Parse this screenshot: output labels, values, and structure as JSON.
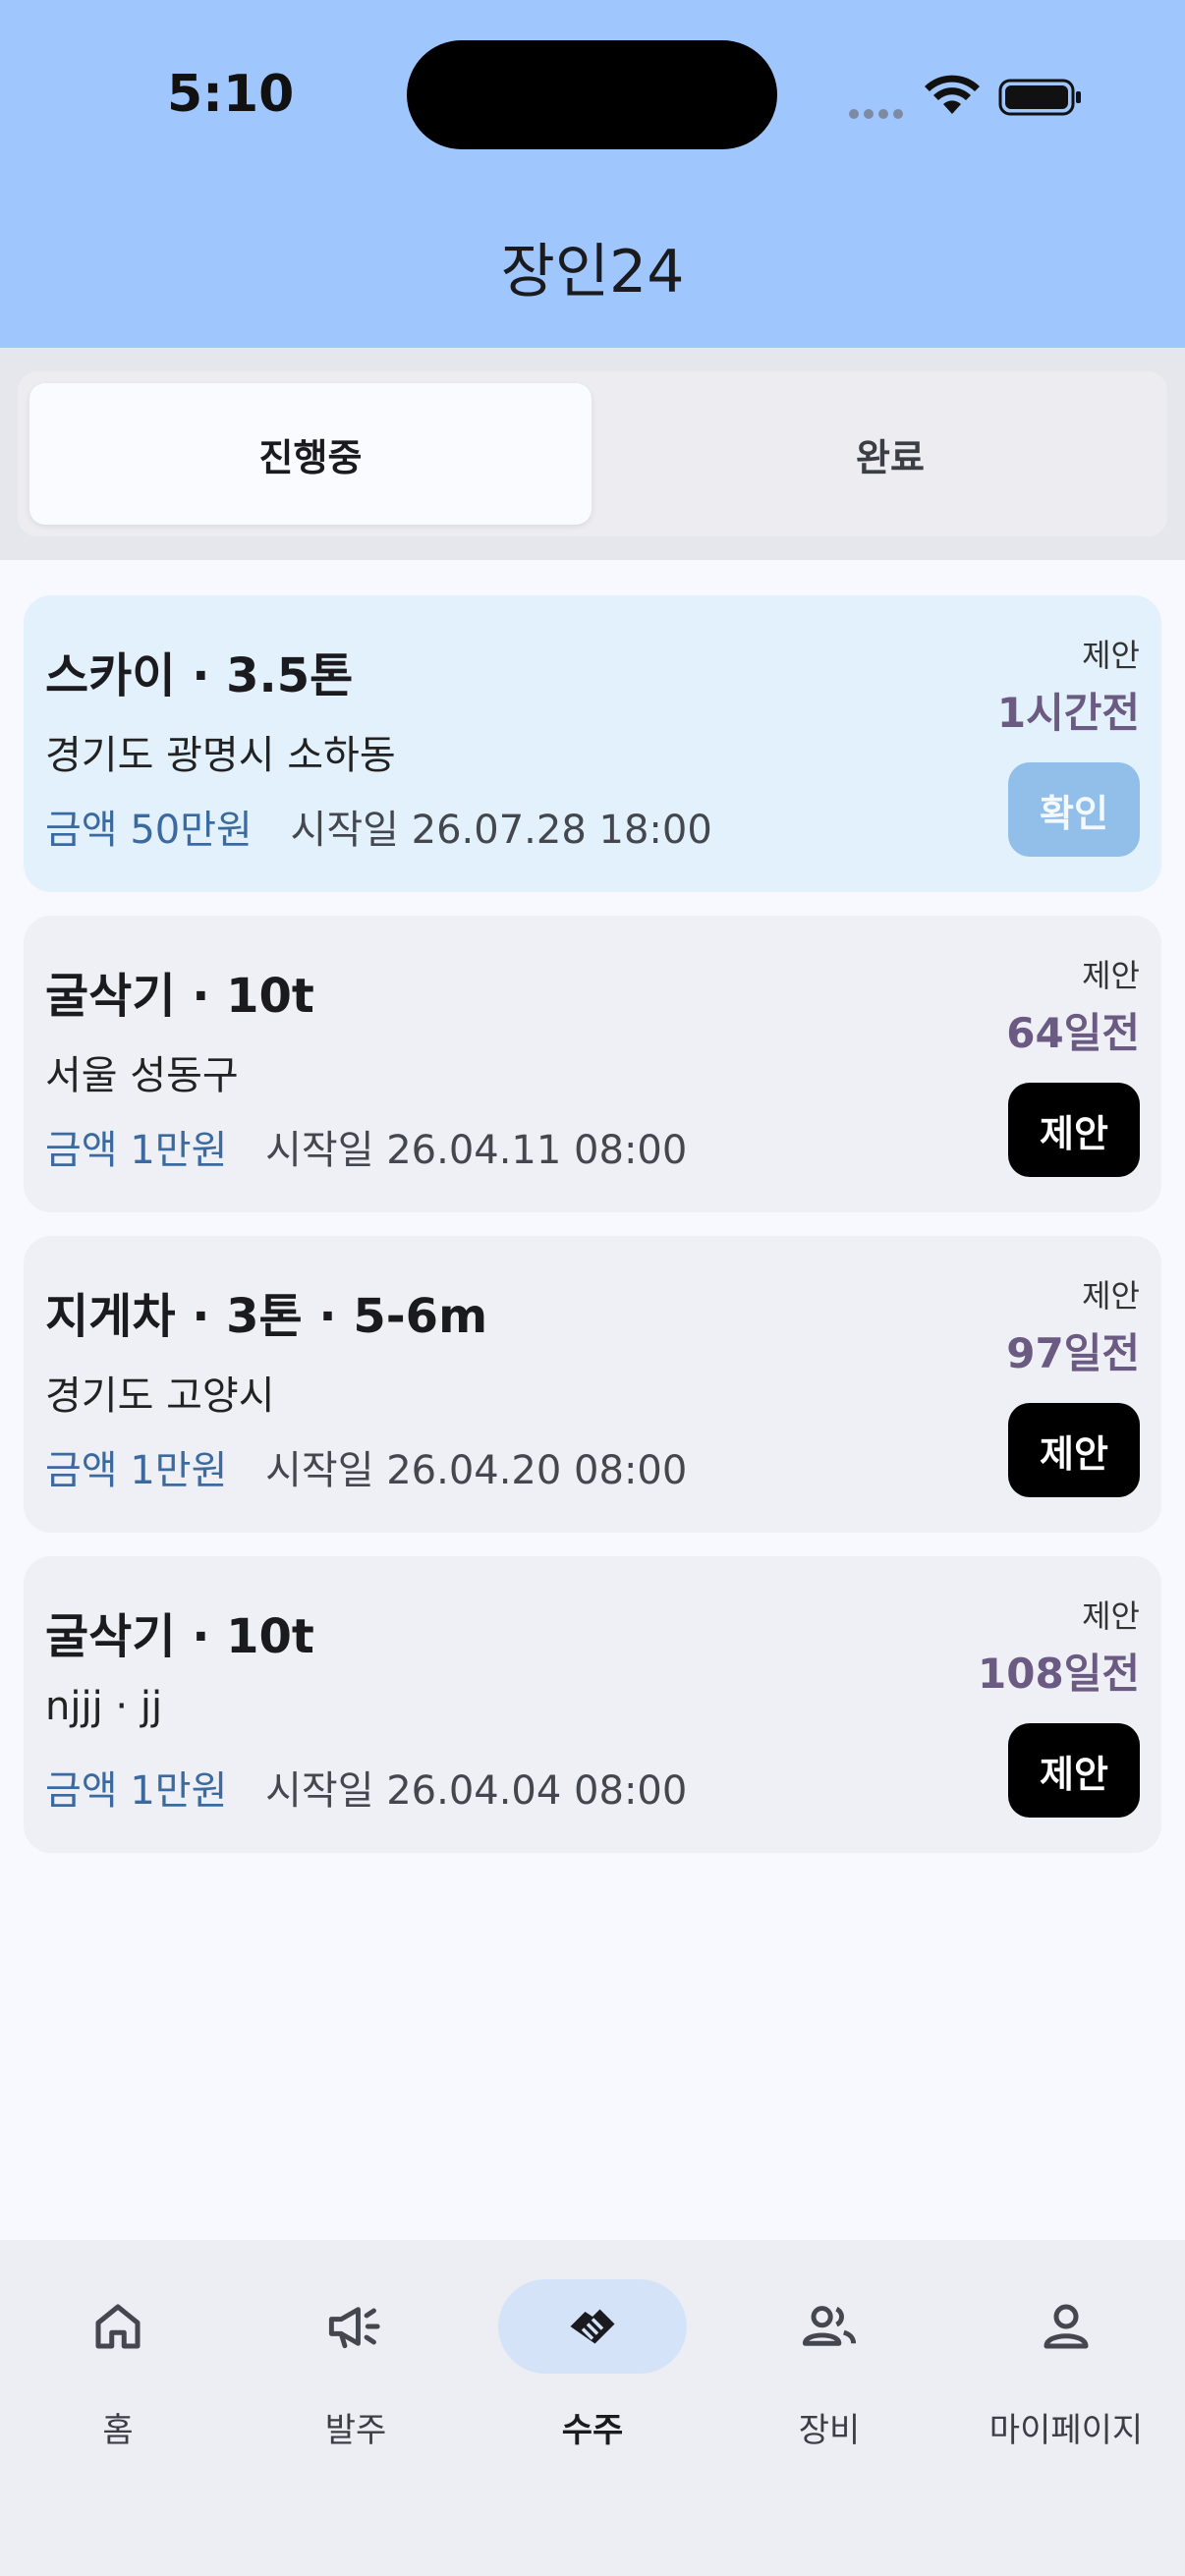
{
  "status_bar": {
    "time": "5:10"
  },
  "app": {
    "title": "장인24"
  },
  "segmented": {
    "tabs": [
      {
        "label": "진행중",
        "active": true
      },
      {
        "label": "완료",
        "active": false
      }
    ]
  },
  "cards": [
    {
      "title": "스카이 · 3.5톤",
      "location": "경기도 광명시 소하동",
      "amount": "금액 50만원",
      "start": "시작일 26.07.28 18:00",
      "kind": "제안",
      "ago": "1시간전",
      "button": "확인"
    },
    {
      "title": "굴삭기 · 10t",
      "location": "서울 성동구",
      "amount": "금액 1만원",
      "start": "시작일 26.04.11 08:00",
      "kind": "제안",
      "ago": "64일전",
      "button": "제안"
    },
    {
      "title": "지게차 · 3톤 · 5-6m",
      "location": "경기도 고양시",
      "amount": "금액 1만원",
      "start": "시작일 26.04.20 08:00",
      "kind": "제안",
      "ago": "97일전",
      "button": "제안"
    },
    {
      "title": "굴삭기 · 10t",
      "location": "njjj · jj",
      "amount": "금액 1만원",
      "start": "시작일 26.04.04 08:00",
      "kind": "제안",
      "ago": "108일전",
      "button": "제안"
    }
  ],
  "bottom_nav": [
    {
      "label": "홈",
      "icon": "home-icon"
    },
    {
      "label": "발주",
      "icon": "megaphone-icon"
    },
    {
      "label": "수주",
      "icon": "handshake-icon",
      "active": true
    },
    {
      "label": "장비",
      "icon": "group-icon"
    },
    {
      "label": "마이페이지",
      "icon": "person-icon"
    }
  ],
  "colors": {
    "header": "#9fc6fd",
    "amount": "#3b6aa0",
    "ago": "#6b5a82",
    "active_nav": "#d5e3f8"
  }
}
